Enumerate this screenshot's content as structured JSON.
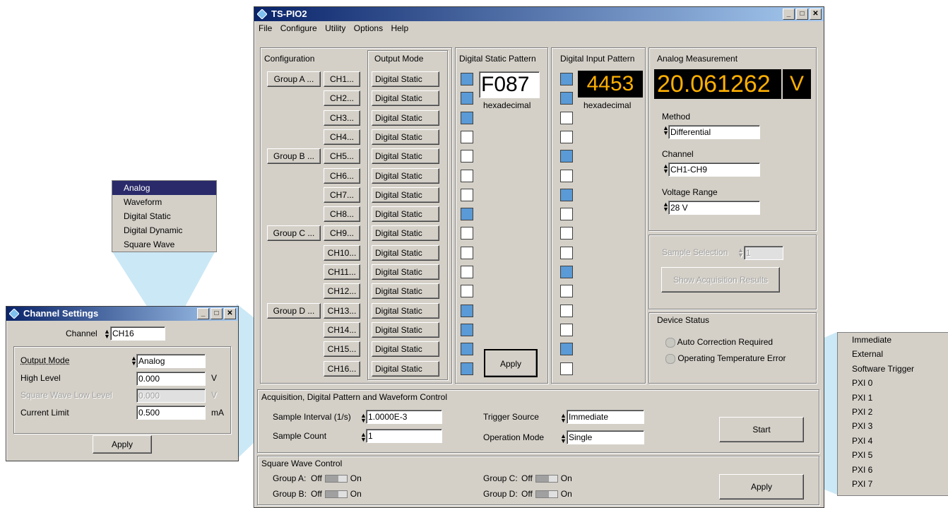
{
  "main_window": {
    "title": "TS-PIO2",
    "menu": [
      "File",
      "Configure",
      "Utility",
      "Options",
      "Help"
    ]
  },
  "configuration": {
    "header": "Configuration",
    "groups": [
      "Group A ...",
      "Group B ...",
      "Group C ...",
      "Group D ..."
    ],
    "channels": [
      "CH1...",
      "CH2...",
      "CH3...",
      "CH4...",
      "CH5...",
      "CH6...",
      "CH7...",
      "CH8...",
      "CH9...",
      "CH10...",
      "CH11...",
      "CH12...",
      "CH13...",
      "CH14...",
      "CH15...",
      "CH16..."
    ]
  },
  "output_mode": {
    "header": "Output Mode",
    "values": [
      "Digital Static",
      "Digital Static",
      "Digital Static",
      "Digital Static",
      "Digital Static",
      "Digital Static",
      "Digital Static",
      "Digital Static",
      "Digital Static",
      "Digital Static",
      "Digital Static",
      "Digital Static",
      "Digital Static",
      "Digital Static",
      "Digital Static",
      "Digital Static"
    ]
  },
  "digital_static": {
    "header": "Digital Static Pattern",
    "hex_value": "F087",
    "hex_label": "hexadecimal",
    "apply": "Apply",
    "bits": [
      1,
      1,
      1,
      0,
      0,
      0,
      0,
      1,
      0,
      0,
      0,
      0,
      1,
      1,
      1,
      1
    ]
  },
  "digital_input": {
    "header": "Digital Input Pattern",
    "hex_value": "4453",
    "hex_label": "hexadecimal",
    "bits": [
      1,
      1,
      0,
      0,
      1,
      0,
      1,
      0,
      0,
      0,
      1,
      0,
      0,
      0,
      1,
      0
    ]
  },
  "analog": {
    "header": "Analog Measurement",
    "reading": "20.061262",
    "unit": "V",
    "method_label": "Method",
    "method_value": "Differential",
    "channel_label": "Channel",
    "channel_value": "CH1-CH9",
    "range_label": "Voltage Range",
    "range_value": "28 V",
    "sample_selection_label": "Sample Selection",
    "sample_selection_value": "1",
    "show_results": "Show Acquisition Results"
  },
  "device_status": {
    "header": "Device Status",
    "items": [
      "Auto Correction Required",
      "Operating Temperature Error"
    ]
  },
  "acquisition": {
    "header": "Acquisition, Digital Pattern and Waveform Control",
    "sample_interval_label": "Sample Interval (1/s)",
    "sample_interval_value": "1.0000E-3",
    "sample_count_label": "Sample Count",
    "sample_count_value": "1",
    "trigger_source_label": "Trigger Source",
    "trigger_source_value": "Immediate",
    "operation_mode_label": "Operation Mode",
    "operation_mode_value": "Single",
    "start": "Start"
  },
  "square_wave": {
    "header": "Square Wave Control",
    "groups": [
      {
        "label": "Group A:",
        "off": "Off",
        "on": "On"
      },
      {
        "label": "Group B:",
        "off": "Off",
        "on": "On"
      },
      {
        "label": "Group C:",
        "off": "Off",
        "on": "On"
      },
      {
        "label": "Group D:",
        "off": "Off",
        "on": "On"
      }
    ],
    "apply": "Apply"
  },
  "channel_settings": {
    "title": "Channel Settings",
    "channel_label": "Channel",
    "channel_value": "CH16",
    "output_mode_label": "Output Mode",
    "output_mode_value": "Analog",
    "high_level_label": "High Level",
    "high_level_value": "0.000",
    "high_level_unit": "V",
    "sq_low_label": "Square Wave Low Level",
    "sq_low_value": "0.000",
    "sq_low_unit": "V",
    "current_limit_label": "Current Limit",
    "current_limit_value": "0.500",
    "current_limit_unit": "mA",
    "apply": "Apply"
  },
  "output_mode_popup": [
    "Analog",
    "Waveform",
    "Digital Static",
    "Digital Dynamic",
    "Square Wave"
  ],
  "trigger_popup": [
    "Immediate",
    "External",
    "Software Trigger",
    "PXI 0",
    "PXI 1",
    "PXI 2",
    "PXI 3",
    "PXI 4",
    "PXI 5",
    "PXI 6",
    "PXI 7"
  ],
  "colors": {
    "bit_on": "#5a9ad6",
    "title_start": "#0a246a",
    "title_end": "#a6caf0",
    "display_bg": "#000000",
    "display_fg": "#ffb000",
    "callout": "#bfe3f5"
  }
}
